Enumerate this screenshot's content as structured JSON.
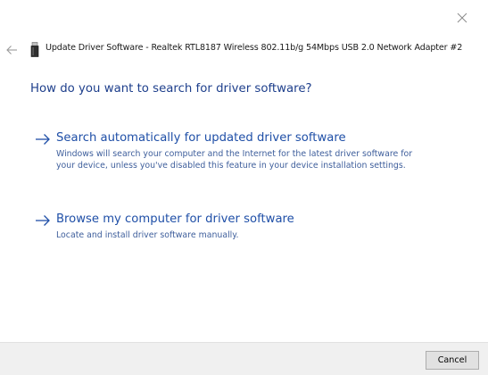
{
  "window": {
    "title": "Update Driver Software - Realtek RTL8187 Wireless 802.11b/g 54Mbps USB 2.0 Network Adapter #2",
    "close_icon": "close-icon",
    "back_icon": "back-arrow-icon",
    "device_icon": "device-icon"
  },
  "main": {
    "heading": "How do you want to search for driver software?",
    "options": [
      {
        "title": "Search automatically for updated driver software",
        "description": "Windows will search your computer and the Internet for the latest driver software for your device, unless you've disabled this feature in your device installation settings.",
        "icon": "arrow-right-icon"
      },
      {
        "title": "Browse my computer for driver software",
        "description": "Locate and install driver software manually.",
        "icon": "arrow-right-icon"
      }
    ]
  },
  "footer": {
    "cancel_label": "Cancel"
  },
  "colors": {
    "heading": "#1e3f8c",
    "link": "#1f4fa7",
    "description": "#3f5f9c",
    "footer_bg": "#f0f0f0",
    "button_bg": "#e1e1e1",
    "button_border": "#adadad"
  }
}
